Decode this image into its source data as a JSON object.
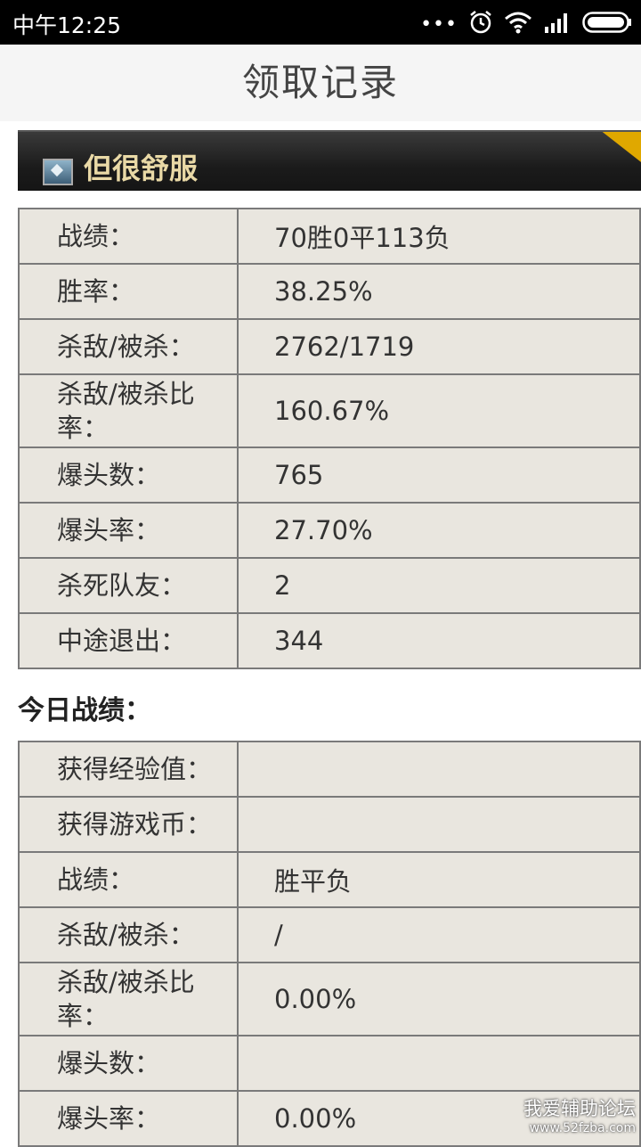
{
  "status_bar": {
    "time": "中午12:25"
  },
  "header": {
    "title": "领取记录"
  },
  "player": {
    "name": "但很舒服"
  },
  "overall_stats": [
    {
      "label": "战绩：",
      "value": "70胜0平113负"
    },
    {
      "label": "胜率：",
      "value": "38.25%"
    },
    {
      "label": "杀敌/被杀：",
      "value": "2762/1719"
    },
    {
      "label": "杀敌/被杀比率：",
      "value": "160.67%"
    },
    {
      "label": "爆头数：",
      "value": "765"
    },
    {
      "label": "爆头率：",
      "value": "27.70%"
    },
    {
      "label": "杀死队友：",
      "value": "2"
    },
    {
      "label": "中途退出：",
      "value": "344"
    }
  ],
  "today": {
    "title": "今日战绩：",
    "stats": [
      {
        "label": "获得经验值：",
        "value": ""
      },
      {
        "label": "获得游戏币：",
        "value": ""
      },
      {
        "label": "战绩：",
        "value": "胜平负"
      },
      {
        "label": "杀敌/被杀：",
        "value": "/"
      },
      {
        "label": "杀敌/被杀比率：",
        "value": "0.00%"
      },
      {
        "label": "爆头数：",
        "value": ""
      },
      {
        "label": "爆头率：",
        "value": "0.00%"
      }
    ]
  },
  "watermark": {
    "line1": "我爱辅助论坛",
    "line2": "www.52fzba.com"
  }
}
